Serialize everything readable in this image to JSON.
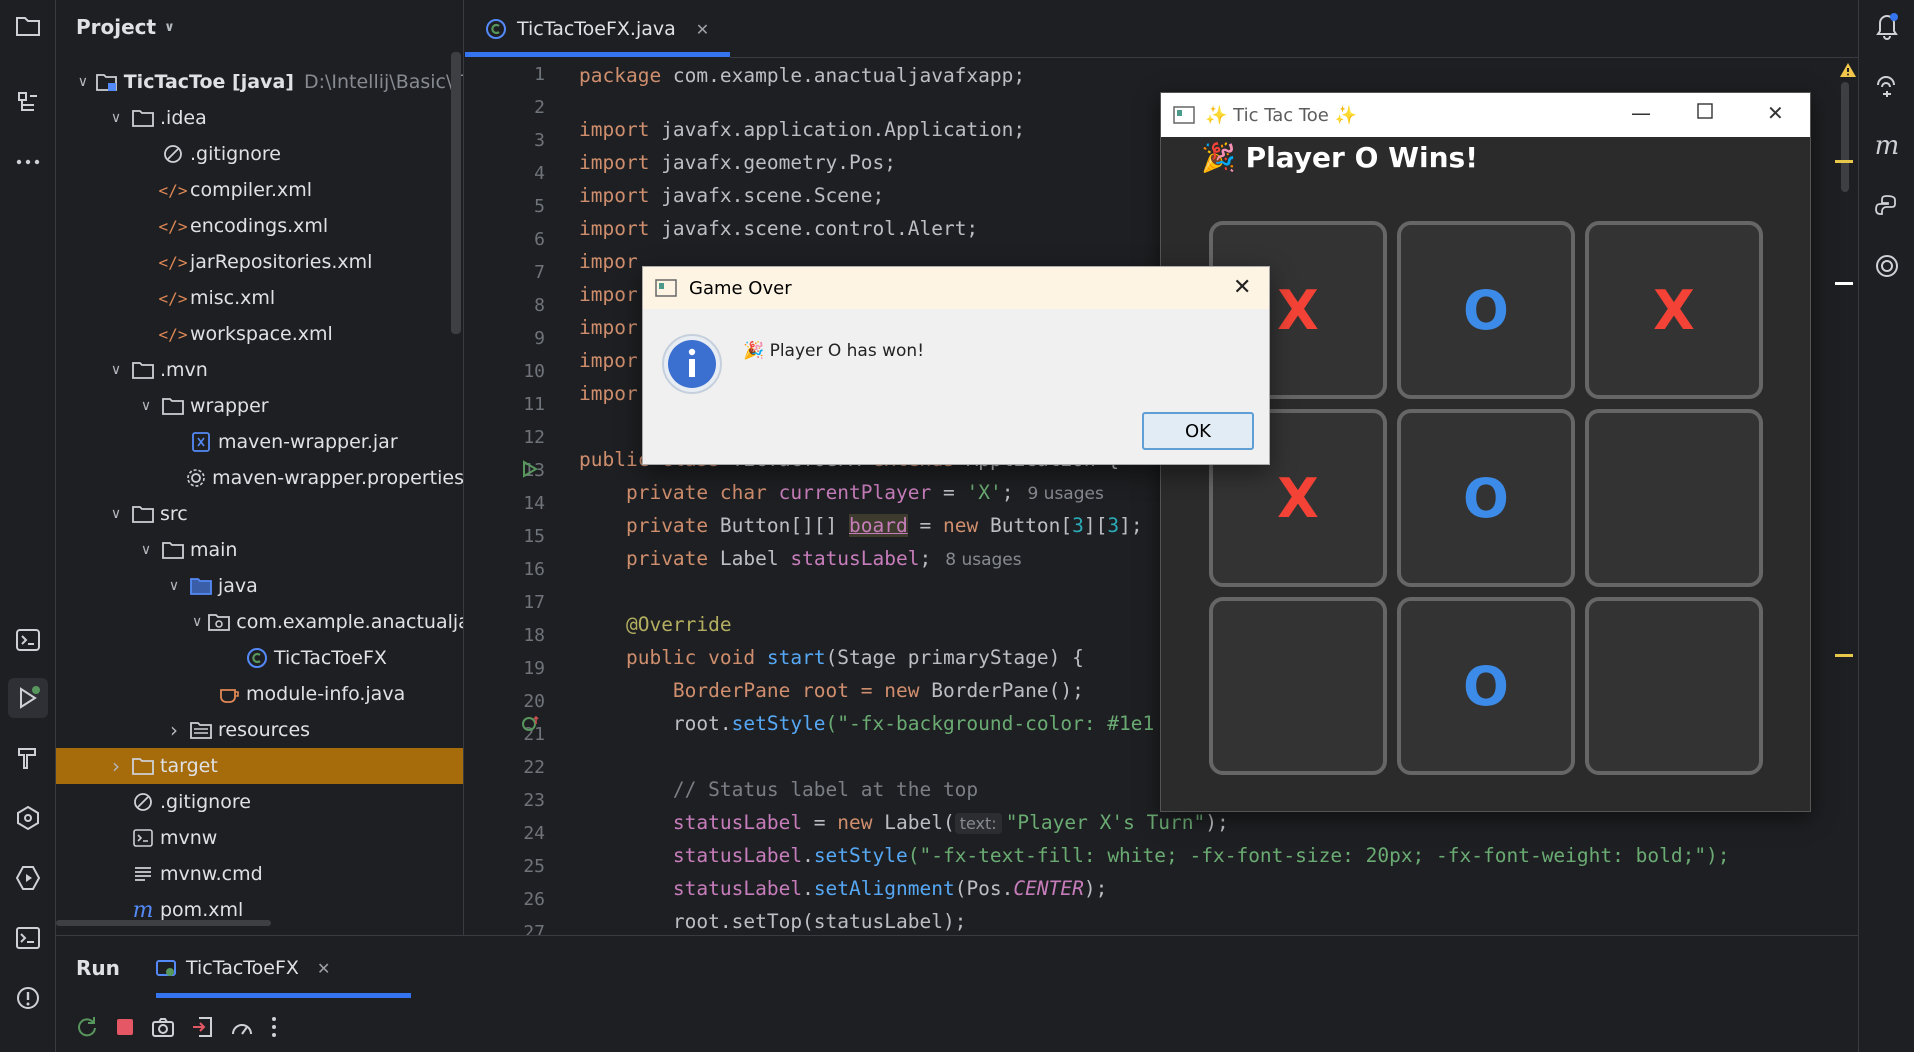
{
  "project_panel": {
    "header": "Project",
    "tree": [
      {
        "label": "TicTacToe [java]",
        "hint": "D:\\Intellij\\Basic\\T",
        "icon": "module-folder-icon",
        "bold": true
      },
      {
        "label": ".idea",
        "icon": "folder-icon"
      },
      {
        "label": ".gitignore",
        "icon": "ignore-file-icon"
      },
      {
        "label": "compiler.xml",
        "icon": "xml-file-icon"
      },
      {
        "label": "encodings.xml",
        "icon": "xml-file-icon"
      },
      {
        "label": "jarRepositories.xml",
        "icon": "xml-file-icon"
      },
      {
        "label": "misc.xml",
        "icon": "xml-file-icon"
      },
      {
        "label": "workspace.xml",
        "icon": "xml-file-icon"
      },
      {
        "label": ".mvn",
        "icon": "folder-icon"
      },
      {
        "label": "wrapper",
        "icon": "folder-icon"
      },
      {
        "label": "maven-wrapper.jar",
        "icon": "jar-file-icon"
      },
      {
        "label": "maven-wrapper.properties",
        "icon": "properties-file-icon"
      },
      {
        "label": "src",
        "icon": "folder-icon"
      },
      {
        "label": "main",
        "icon": "folder-icon"
      },
      {
        "label": "java",
        "icon": "source-folder-icon"
      },
      {
        "label": "com.example.anactualja",
        "icon": "package-icon"
      },
      {
        "label": "TicTacToeFX",
        "icon": "java-class-icon"
      },
      {
        "label": "module-info.java",
        "icon": "module-info-icon"
      },
      {
        "label": "resources",
        "icon": "resources-folder-icon"
      },
      {
        "label": "target",
        "icon": "folder-icon"
      },
      {
        "label": ".gitignore",
        "icon": "ignore-file-icon"
      },
      {
        "label": "mvnw",
        "icon": "shell-file-icon"
      },
      {
        "label": "mvnw.cmd",
        "icon": "text-file-icon"
      },
      {
        "label": "pom.xml",
        "icon": "maven-icon"
      }
    ]
  },
  "editor": {
    "tab_label": "TicTacToeFX.java",
    "lines": [
      "1",
      "2",
      "3",
      "4",
      "5",
      "6",
      "7",
      "8",
      "9",
      "10",
      "11",
      "12",
      "13",
      "14",
      "15",
      "16",
      "17",
      "18",
      "19",
      "20",
      "21",
      "22",
      "23",
      "24",
      "25",
      "26",
      "27"
    ],
    "code": {
      "l1_kw": "package",
      "l1_rest": " com.example.anactualjavafxapp;",
      "l3_rest": " javafx.application.Application;",
      "l4_rest": " javafx.geometry.Pos;",
      "l5_rest": " javafx.scene.Scene;",
      "l6_rest": " javafx.scene.control.Alert;",
      "import_kw": "import",
      "import_trunc": "impor",
      "l13_public": "public",
      "l13_class": "class",
      "l13_name": "TicTacToeFX",
      "l13_extends": "extends",
      "l13_type": "Application {",
      "l14_private": "private char",
      "l14_field": "currentPlayer",
      "l14_eq": " = ",
      "l14_str": "'X'",
      "l14_semi": ";",
      "l14_usages": "9 usages",
      "l15_private": "private",
      "l15_type": " Button[][] ",
      "l15_field": "board",
      "l15_eq": " = ",
      "l15_new": "new",
      "l15_rest1": " Button[",
      "l15_n1": "3",
      "l15_mid": "][",
      "l15_n2": "3",
      "l15_end": "];",
      "l16_private": "private",
      "l16_type": " Label ",
      "l16_field": "statusLabel",
      "l16_semi": ";",
      "l16_usages": "8 usages",
      "l18_ann": "@Override",
      "l19_kw": "public void",
      "l19_mth": "start",
      "l19_rest": "(Stage primaryStage) {",
      "l20_type": "BorderPane root = ",
      "l20_new": "new",
      "l20_rest": " BorderPane();",
      "l21_obj": "root.",
      "l21_mth": "setStyle",
      "l21_str": "(\"-fx-background-color: #1e1",
      "l23_cmt": "// Status label at the top",
      "l24_field": "statusLabel",
      "l24_eq": " = ",
      "l24_new": "new",
      "l24_type": " Label(",
      "l24_param": "text:",
      "l24_str": "\"Player X's Turn\"",
      "l24_end": ");",
      "l25_field": "statusLabel",
      "l25_dot": ".",
      "l25_mth": "setStyle",
      "l25_str": "(\"-fx-text-fill: white; -fx-font-size: 20px; -fx-font-weight: bold;\");",
      "l26_field": "statusLabel",
      "l26_dot": ".",
      "l26_mth": "setAlignment",
      "l26_open": "(Pos.",
      "l26_const": "CENTER",
      "l26_end": ");",
      "l27_text": "root.setTop(statusLabel);"
    }
  },
  "ttt_window": {
    "title": "✨ Tic Tac Toe ✨",
    "status": "🎉 Player O Wins!",
    "board": [
      "X",
      "O",
      "X",
      "X",
      "O",
      "",
      "",
      "O",
      ""
    ]
  },
  "dialog": {
    "title": "Game Over",
    "message": "🎉 Player O has won!",
    "ok_label": "OK"
  },
  "run_panel": {
    "title": "Run",
    "tab_label": "TicTacToeFX"
  },
  "colors": {
    "accent": "#3574f0",
    "selected_row": "#a66b0b",
    "x_color": "#f44336",
    "o_color": "#3d8be8"
  }
}
